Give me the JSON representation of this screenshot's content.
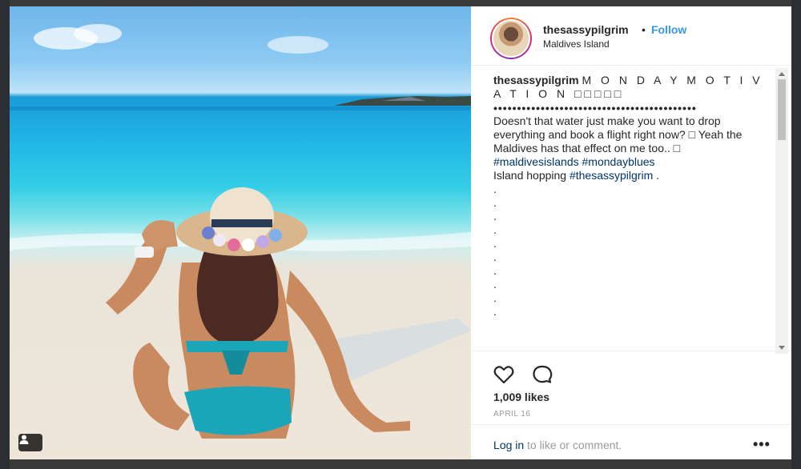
{
  "post": {
    "username": "thesassypilgrim",
    "separator": "•",
    "follow_label": "Follow",
    "location": "Maldives Island",
    "caption": {
      "username": "thesassypilgrim",
      "headline": "M O N D A Y M O T I V A T I O N □□□□□",
      "bullets": "•••••••••••••••••••••••••••••••••••••••••••",
      "text": "Doesn't that water just make you want to drop everything and book a flight right now? □ Yeah the Maldives has that effect on me too.. □",
      "hashtags": "#maldivesislands #mondayblues",
      "line2_prefix": "Island hopping ",
      "line2_tag": "#thesassypilgrim",
      "line2_suffix": " .",
      "dots": [
        ".",
        ".",
        ".",
        ".",
        ".",
        ".",
        ".",
        ".",
        ".",
        "."
      ]
    },
    "likes": "1,009 likes",
    "date": "APRIL 16",
    "login_link": "Log in",
    "login_suffix": " to like or comment.",
    "more_label": "•••"
  },
  "icons": {
    "like": "heart-icon",
    "comment": "comment-icon",
    "user_tag": "user-tag-icon"
  },
  "colors": {
    "follow": "#3897f0",
    "hashtag": "#003569",
    "muted": "#999999"
  }
}
